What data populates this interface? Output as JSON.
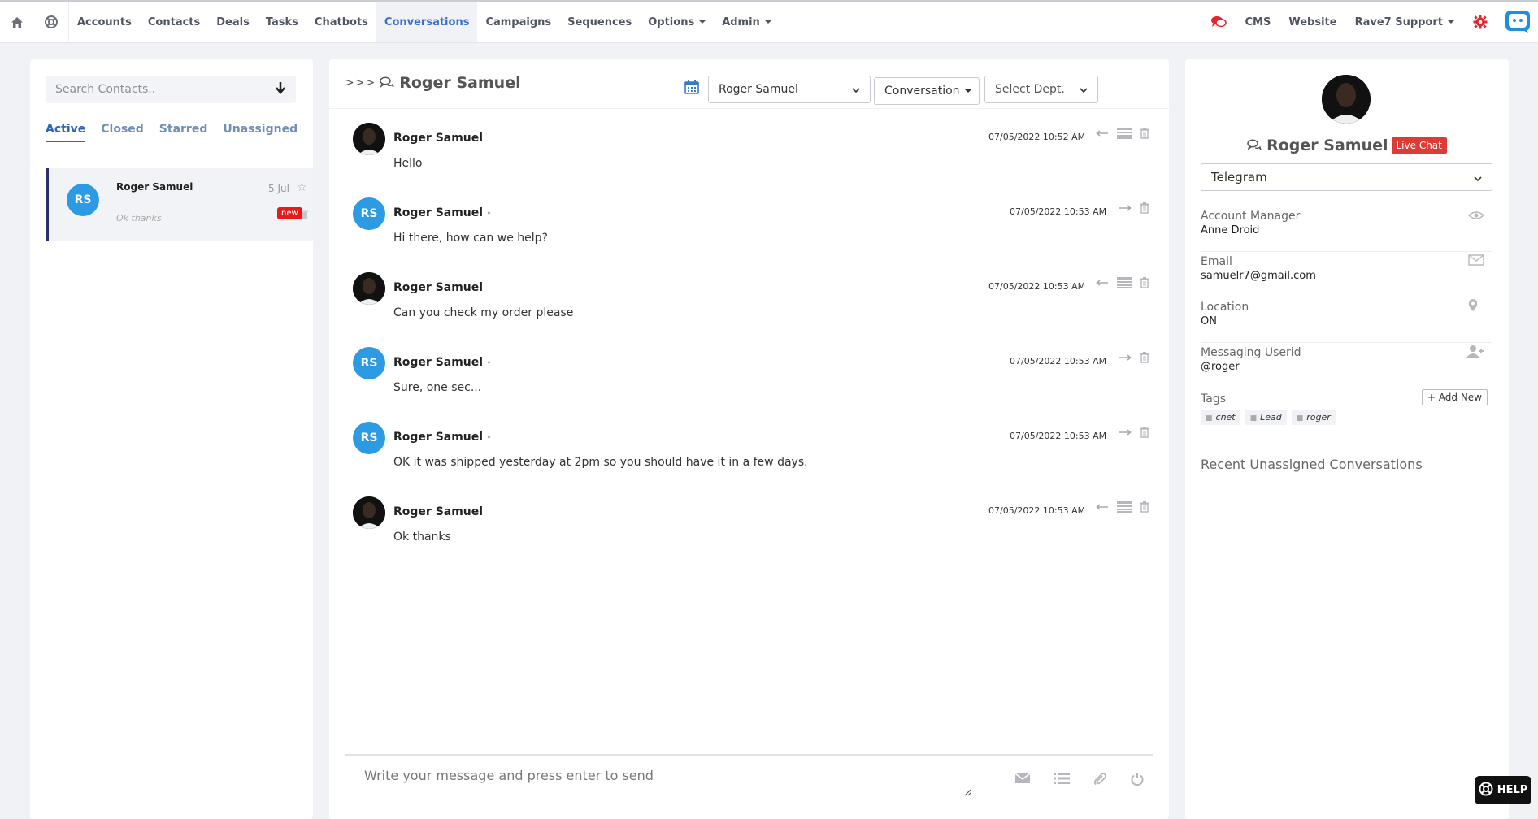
{
  "nav": {
    "items": [
      {
        "label": "Accounts"
      },
      {
        "label": "Contacts"
      },
      {
        "label": "Deals"
      },
      {
        "label": "Tasks"
      },
      {
        "label": "Chatbots"
      },
      {
        "label": "Conversations",
        "active": true
      },
      {
        "label": "Campaigns"
      },
      {
        "label": "Sequences"
      },
      {
        "label": "Options"
      },
      {
        "label": "Admin"
      }
    ],
    "right": {
      "cms": "CMS",
      "website": "Website",
      "support": "Rave7 Support"
    },
    "accent_color": "#3a6fcf"
  },
  "left": {
    "search_placeholder": "Search Contacts..",
    "tabs": [
      "Active",
      "Closed",
      "Starred",
      "Unassigned"
    ],
    "conversation": {
      "initials": "RS",
      "name": "Roger Samuel",
      "date": "5 Jul",
      "preview": "Ok thanks",
      "badge": "new"
    }
  },
  "chat": {
    "arrows": ">>>",
    "title": "Roger Samuel",
    "contact_select": "Roger Samuel",
    "conversation_select": "Conversation",
    "dept_select": "Select Dept.",
    "messages": [
      {
        "name": "Roger Samuel",
        "text": "Hello",
        "time": "07/05/2022 10:52 AM",
        "inbound": true
      },
      {
        "name": "Roger Samuel",
        "text": "Hi there, how can we help?",
        "time": "07/05/2022 10:53 AM",
        "inbound": false,
        "initials": "RS"
      },
      {
        "name": "Roger Samuel",
        "text": "Can you check my order please",
        "time": "07/05/2022 10:53 AM",
        "inbound": true
      },
      {
        "name": "Roger Samuel",
        "text": "Sure, one sec...",
        "time": "07/05/2022 10:53 AM",
        "inbound": false,
        "initials": "RS"
      },
      {
        "name": "Roger Samuel",
        "text": "OK it was shipped yesterday at 2pm so you should have it in a few days.",
        "time": "07/05/2022 10:53 AM",
        "inbound": false,
        "initials": "RS"
      },
      {
        "name": "Roger Samuel",
        "text": "Ok thanks",
        "time": "07/05/2022 10:53 AM",
        "inbound": true
      }
    ],
    "composer_placeholder": "Write your message and press enter to send"
  },
  "profile": {
    "name": "Roger Samuel",
    "badge": "Live Chat",
    "channel": "Telegram",
    "fields": [
      {
        "label": "Account Manager",
        "value": "Anne Droid",
        "icon": "eye-icon"
      },
      {
        "label": "Email",
        "value": "samuelr7@gmail.com",
        "icon": "envelope-icon"
      },
      {
        "label": "Location",
        "value": "ON",
        "icon": "map-pin-icon"
      },
      {
        "label": "Messaging Userid",
        "value": "@roger",
        "icon": "user-plus-icon"
      }
    ],
    "tags_label": "Tags",
    "add_new": "+ Add New",
    "tags": [
      "cnet",
      "Lead",
      "roger"
    ],
    "recent_title": "Recent Unassigned Conversations"
  },
  "help": {
    "label": "HELP"
  }
}
